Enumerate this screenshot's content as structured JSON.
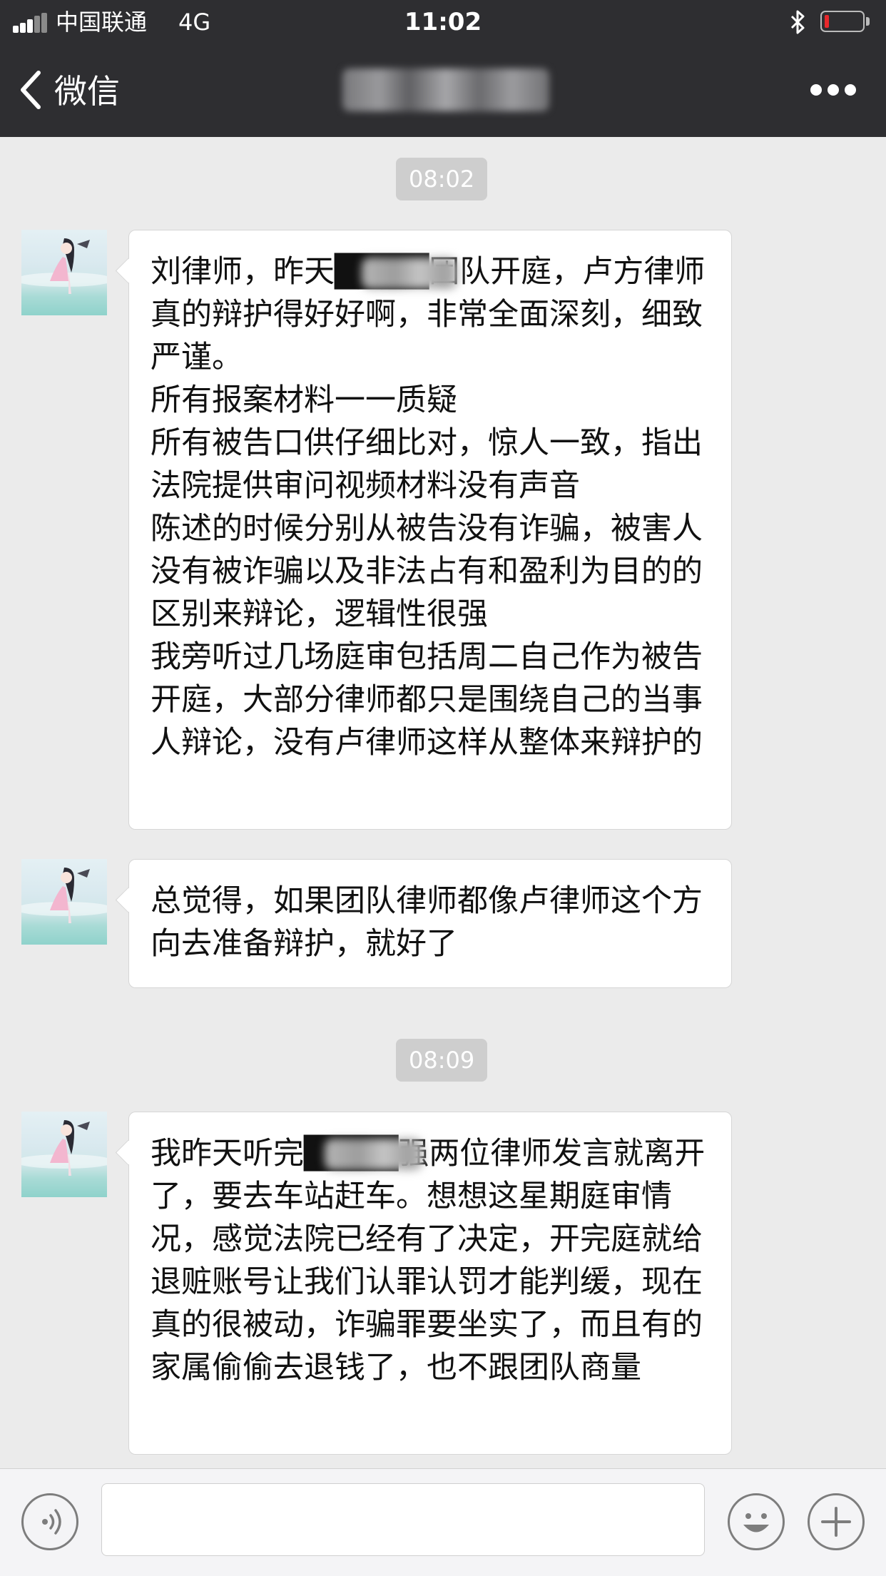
{
  "status_bar": {
    "carrier": "中国联通",
    "network": "4G",
    "time": "11:02",
    "battery_level": 0.12,
    "battery_color": "#e8272b"
  },
  "nav_bar": {
    "back_label": "微信",
    "back_icon": "chevron-left-icon",
    "more_icon": "more-dots-icon"
  },
  "chat": {
    "timestamps": [
      "08:02",
      "08:09"
    ],
    "messages": [
      {
        "text": "刘律师，昨天████团队开庭，卢方律师真的辩护得好好啊，非常全面深刻，细致严谨。\n所有报案材料一一质疑\n所有被告口供仔细比对，惊人一致，指出法院提供审问视频材料没有声音\n陈述的时候分别从被告没有诈骗，被害人没有被诈骗以及非法占有和盈利为目的的区别来辩论，逻辑性很强\n我旁听过几场庭审包括周二自己作为被告开庭，大部分律师都只是围绕自己的当事人辩论，没有卢律师这样从整体来辩护的"
      },
      {
        "text": "总觉得，如果团队律师都像卢律师这个方向去准备辩护，就好了"
      },
      {
        "text": "我昨天听完████强两位律师发言就离开了，要去车站赶车。想想这星期庭审情况，感觉法院已经有了决定，开完庭就给退赃账号让我们认罪认罚才能判缓，现在真的很被动，诈骗罪要坐实了，而且有的家属偷偷去退钱了，也不跟团队商量"
      }
    ]
  },
  "input_bar": {
    "voice_icon": "voice-icon",
    "emoji_icon": "emoji-icon",
    "add_icon": "plus-icon",
    "placeholder": ""
  }
}
